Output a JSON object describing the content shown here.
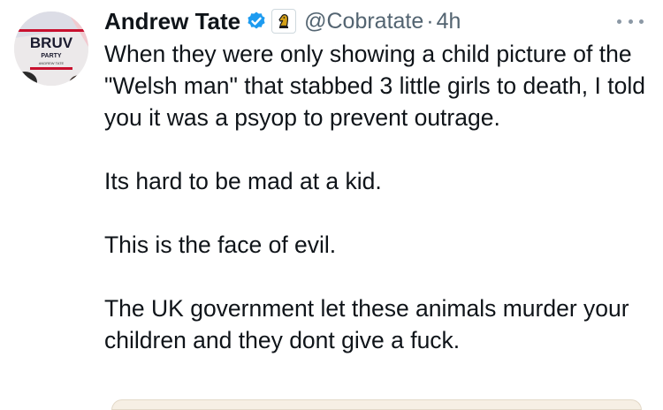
{
  "author": {
    "display_name": "Andrew Tate",
    "handle": "@Cobratate",
    "separator": "·",
    "timestamp": "4h",
    "verified_icon": "verified-badge-icon",
    "affiliate_icon": "chess-knight-affiliate-icon",
    "avatar": {
      "logo_text": "BRUV",
      "logo_subtext": "PARTY",
      "logo_small": "ANDREW TATE",
      "accent_color": "#c8102e",
      "bg_color": "#e9e6e6"
    }
  },
  "more_icon": "more-options-icon",
  "tweet": {
    "paragraphs": [
      "When they were only showing a child picture of the \"Welsh man\" that stabbed 3 little girls to death, I told you it was a psyop to prevent outrage.",
      "Its hard to be mad at a kid.",
      "This is the face of evil.",
      "The UK government let these animals murder your children and they dont give a fuck."
    ]
  },
  "colors": {
    "text": "#0f1419",
    "secondary": "#536471",
    "verified_blue": "#1d9bf0",
    "affiliate_gold": "#d4a017"
  }
}
